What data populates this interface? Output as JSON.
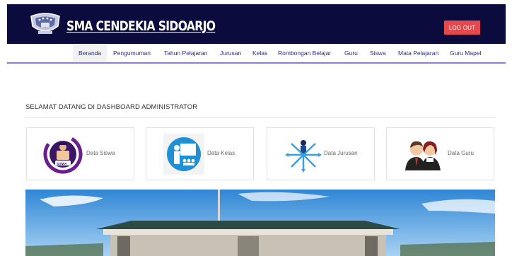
{
  "header": {
    "title": "SMA CENDEKIA SIDOARJO",
    "logout_label": "LOG OUT",
    "accent": "#0b0b3d",
    "logout_color": "#e5484d"
  },
  "nav": {
    "items": [
      {
        "label": "Beranda",
        "active": true
      },
      {
        "label": "Pengumuman"
      },
      {
        "label": "Tahun Pelajaran"
      },
      {
        "label": "Jurusan"
      },
      {
        "label": "Kelas"
      },
      {
        "label": "Rombongan Belajar"
      },
      {
        "label": "Guru"
      },
      {
        "label": "Siswa"
      },
      {
        "label": "Mata Pelajaran"
      },
      {
        "label": "Guru Mapel"
      }
    ]
  },
  "main": {
    "welcome": "SELAMAT DATANG DI DASHBOARD ADMINISTRATOR",
    "cards": [
      {
        "label": "Data Siswa",
        "icon": "student-icon"
      },
      {
        "label": "Data Kelas",
        "icon": "teacher-board-icon"
      },
      {
        "label": "Data Jurusan",
        "icon": "directions-icon"
      },
      {
        "label": "Data Guru",
        "icon": "teachers-icon"
      }
    ],
    "siswa_badge": "SISWA"
  }
}
